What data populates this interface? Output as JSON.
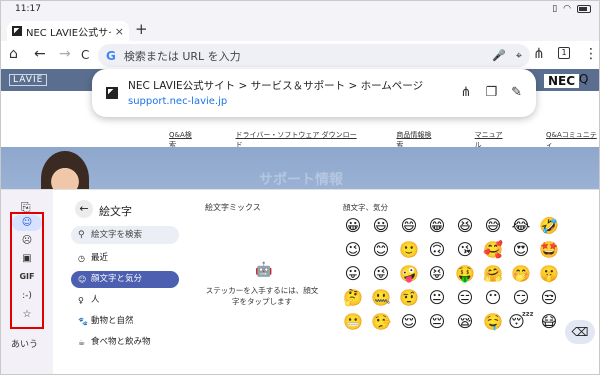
{
  "status": {
    "time": "11:17"
  },
  "tab": {
    "title": "NEC LAVIE公式サイ",
    "close": "×",
    "new_tab": "+"
  },
  "toolbar": {
    "home": "⌂",
    "back": "←",
    "forward": "→",
    "reload": "C",
    "google_logo": "G",
    "omnibox_placeholder": "検索または URL を入力",
    "mic": "🎤",
    "lens": "⌖",
    "share": "⋔",
    "tab_count": "1",
    "menu": "⋮"
  },
  "page": {
    "lavie_logo": "LAVIE",
    "nec_logo": "NEC",
    "search_icon": "Q",
    "links": [
      "Q&A検索",
      "ドライバー・ソフトウェア ダウンロード",
      "商品情報検索",
      "マニュアル",
      "Q&Aコミュニティ"
    ],
    "hero_title": "サポート情報"
  },
  "suggestion": {
    "title": "NEC LAVIE公式サイト > サービス＆サポート > ホームページ",
    "url": "support.nec-lavie.jp",
    "share_icon": "⋔",
    "copy_icon": "❐",
    "edit_icon": "✎"
  },
  "keyboard": {
    "rail_top": "⎘",
    "rail_items": [
      "☺",
      "☹",
      "▣",
      "GIF",
      ":-)",
      "☆"
    ],
    "rail_bottom": "あいう",
    "category_title": "絵文字",
    "back": "←",
    "search_placeholder": "絵文字を検索",
    "categories": [
      {
        "icon": "◷",
        "label": "最近"
      },
      {
        "icon": "☺",
        "label": "顔文字と気分"
      },
      {
        "icon": "♀",
        "label": "人"
      },
      {
        "icon": "🐾",
        "label": "動物と自然"
      },
      {
        "icon": "☕",
        "label": "食べ物と飲み物"
      }
    ],
    "mix_title": "絵文字ミックス",
    "mix_icon": "🤖",
    "mix_text": "ステッカーを入手するには、顔文字をタップします",
    "emoji_title": "顔文字、気分",
    "emojis": [
      "😀",
      "😃",
      "😄",
      "😁",
      "😆",
      "😅",
      "😂",
      "🤣",
      "😉",
      "😊",
      "🙂",
      "🙃",
      "😘",
      "🥰",
      "😍",
      "🤩",
      "😛",
      "😜",
      "🤪",
      "😝",
      "🤑",
      "🤗",
      "🤭",
      "🤫",
      "🤔",
      "🤐",
      "🤨",
      "😐",
      "😑",
      "😶",
      "😏",
      "😒",
      "😬",
      "🤥",
      "😌",
      "😔",
      "😪",
      "🤤",
      "😴",
      "😷"
    ],
    "delete_key": "⌫"
  }
}
